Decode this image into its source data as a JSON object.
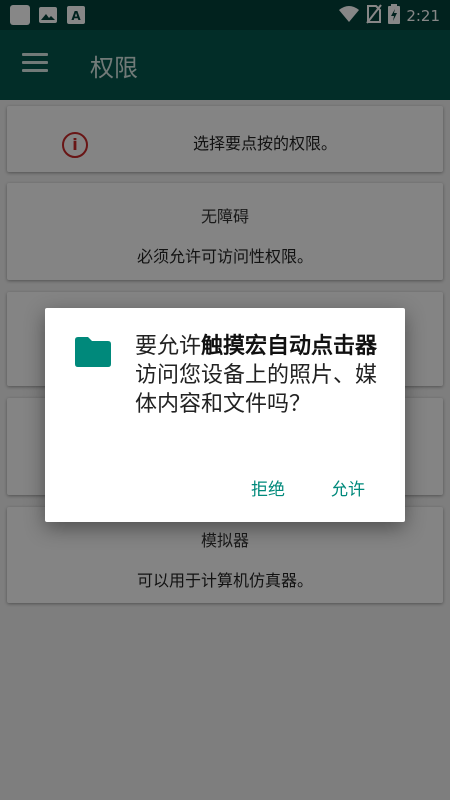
{
  "status_bar": {
    "time": "2:21",
    "left_icons": [
      "app-icon",
      "image-icon",
      "font-icon"
    ],
    "right_icons": [
      "wifi-icon",
      "no-sim-icon",
      "battery-icon"
    ]
  },
  "app_bar": {
    "title": "权限",
    "menu_icon": "hamburger-menu-icon"
  },
  "cards": [
    {
      "icon": "info-icon",
      "title": "",
      "desc": "选择要点按的权限。"
    },
    {
      "title": "无障碍",
      "desc": "必须允许可访问性权限。"
    },
    {
      "title": "",
      "desc": ""
    },
    {
      "title": "",
      "desc": ""
    },
    {
      "title": "模拟器",
      "desc": "可以用于计算机仿真器。"
    }
  ],
  "dialog": {
    "icon": "folder-icon",
    "message_prefix": "要允许",
    "app_name": "触摸宏自动点击器",
    "message_suffix": "访问您设备上的照片、媒体内容和文件吗？",
    "deny_label": "拒绝",
    "allow_label": "允许",
    "accent": "#00897b"
  },
  "colors": {
    "status_bar": "#03403a",
    "app_bar": "#05564d",
    "info_icon": "#c62828"
  }
}
